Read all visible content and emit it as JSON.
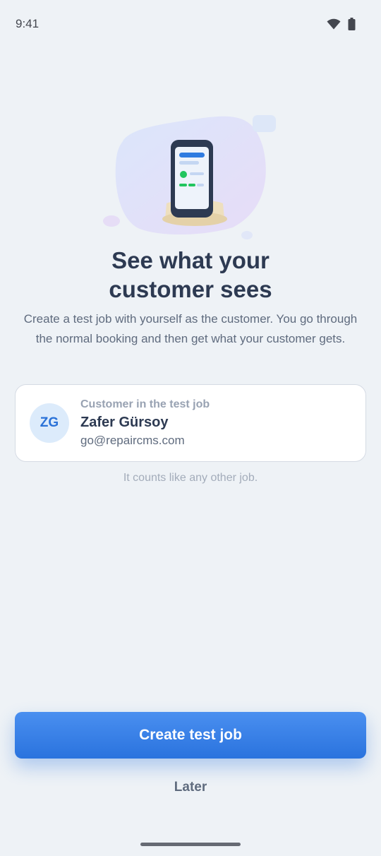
{
  "status_bar": {
    "time": "9:41",
    "icons": [
      "wifi-icon",
      "battery-icon"
    ]
  },
  "hero": {
    "illustration": "phone-on-stand-icon"
  },
  "onboarding": {
    "title_line1": "See what your",
    "title_line2": "customer sees",
    "subtitle": "Create a test job with yourself as the customer. You go through the normal booking and then get what your customer gets."
  },
  "customer_card": {
    "label": "Customer in the test job",
    "initials": "ZG",
    "name": "Zafer Gürsoy",
    "email": "go@repaircms.com"
  },
  "note": "It counts like any other job.",
  "actions": {
    "primary_label": "Create test job",
    "secondary_label": "Later"
  },
  "colors": {
    "background": "#eef2f6",
    "accent": "#2a73de",
    "title": "#2d3a52",
    "muted": "#a3acba",
    "success": "#22c55e"
  }
}
